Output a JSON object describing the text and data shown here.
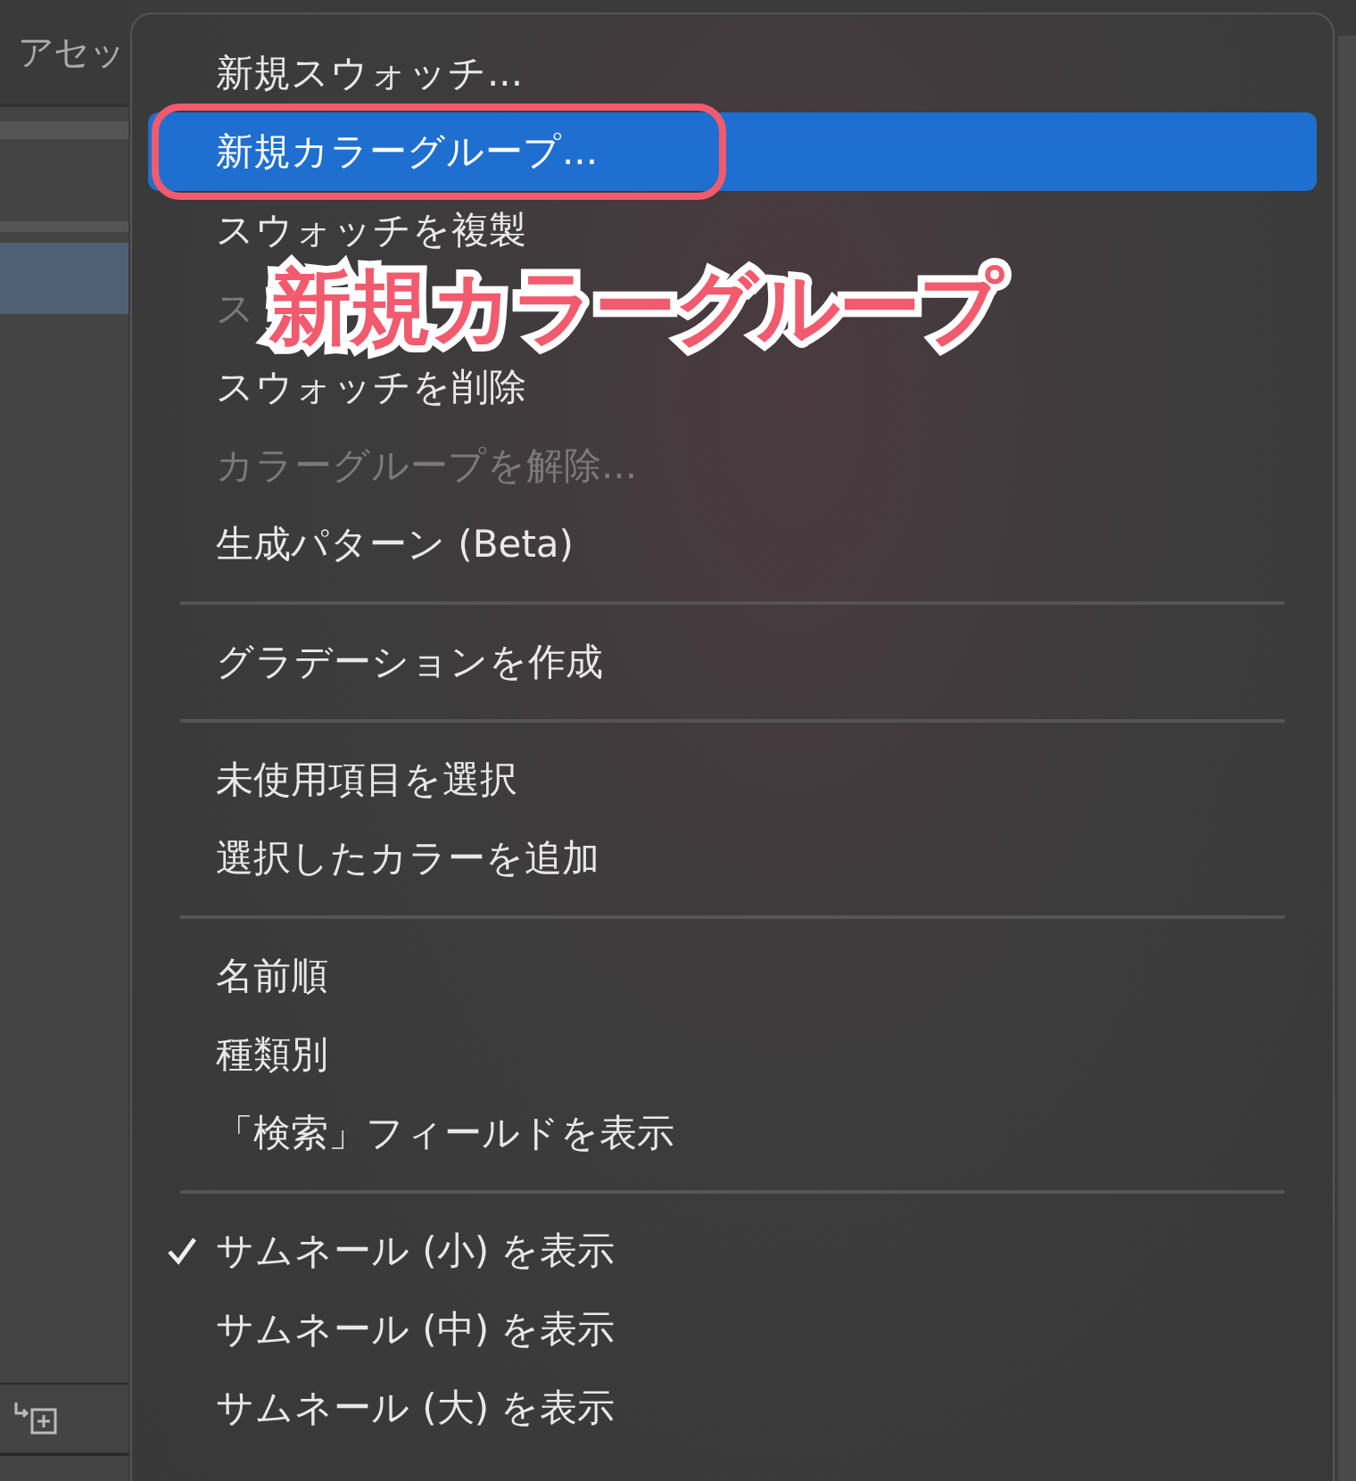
{
  "panel": {
    "title": "アセッ"
  },
  "menu": {
    "items": [
      {
        "kind": "item",
        "label": "新規スウォッチ...",
        "selected": false,
        "disabled": false,
        "checked": false
      },
      {
        "kind": "item",
        "label": "新規カラーグループ...",
        "selected": true,
        "disabled": false,
        "checked": false
      },
      {
        "kind": "item",
        "label": "スウォッチを複製",
        "selected": false,
        "disabled": false,
        "checked": false
      },
      {
        "kind": "item",
        "label": "ス",
        "selected": false,
        "disabled": true,
        "checked": false
      },
      {
        "kind": "item",
        "label": "スウォッチを削除",
        "selected": false,
        "disabled": false,
        "checked": false
      },
      {
        "kind": "item",
        "label": "カラーグループを解除...",
        "selected": false,
        "disabled": true,
        "checked": false
      },
      {
        "kind": "item",
        "label": "生成パターン (Beta)",
        "selected": false,
        "disabled": false,
        "checked": false
      },
      {
        "kind": "separator"
      },
      {
        "kind": "item",
        "label": "グラデーションを作成",
        "selected": false,
        "disabled": false,
        "checked": false
      },
      {
        "kind": "separator"
      },
      {
        "kind": "item",
        "label": "未使用項目を選択",
        "selected": false,
        "disabled": false,
        "checked": false
      },
      {
        "kind": "item",
        "label": "選択したカラーを追加",
        "selected": false,
        "disabled": false,
        "checked": false
      },
      {
        "kind": "separator"
      },
      {
        "kind": "item",
        "label": "名前順",
        "selected": false,
        "disabled": false,
        "checked": false
      },
      {
        "kind": "item",
        "label": "種類別",
        "selected": false,
        "disabled": false,
        "checked": false
      },
      {
        "kind": "item",
        "label": "「検索」フィールドを表示",
        "selected": false,
        "disabled": false,
        "checked": false
      },
      {
        "kind": "separator"
      },
      {
        "kind": "item",
        "label": "サムネール (小) を表示",
        "selected": false,
        "disabled": false,
        "checked": true
      },
      {
        "kind": "item",
        "label": "サムネール (中) を表示",
        "selected": false,
        "disabled": false,
        "checked": false
      },
      {
        "kind": "item",
        "label": "サムネール (大) を表示",
        "selected": false,
        "disabled": false,
        "checked": false
      }
    ]
  },
  "annotation": {
    "caption": "新規カラーグループ"
  }
}
